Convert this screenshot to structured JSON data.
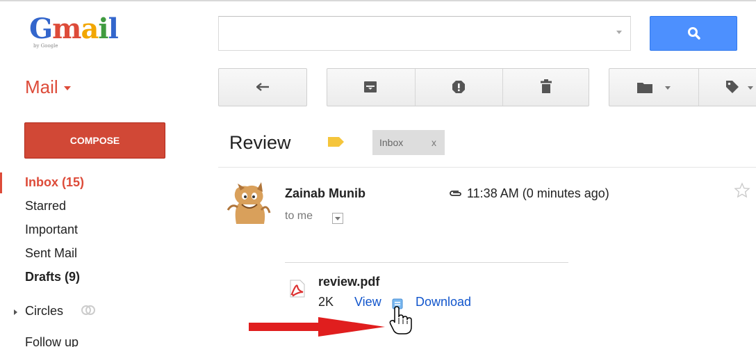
{
  "header": {
    "logo_text": "Gmail",
    "logo_subtext": "by Google",
    "search": {
      "value": "",
      "placeholder": ""
    }
  },
  "mail_menu": {
    "label": "Mail"
  },
  "toolbar": {
    "reply_icon": "reply-icon",
    "archive_icon": "archive-icon",
    "spam_icon": "report-spam-icon",
    "delete_icon": "trash-icon",
    "move_icon": "folder-icon",
    "labels_icon": "label-tag-icon"
  },
  "sidebar": {
    "compose_label": "COMPOSE",
    "items": [
      {
        "label": "Inbox (15)",
        "state": "active"
      },
      {
        "label": "Starred"
      },
      {
        "label": "Important"
      },
      {
        "label": "Sent Mail"
      },
      {
        "label": "Drafts (9)",
        "state": "bold"
      },
      {
        "label": "Circles"
      },
      {
        "label": "Follow up"
      }
    ]
  },
  "message": {
    "subject": "Review",
    "label_chip": {
      "text": "Inbox",
      "remove": "x"
    },
    "sender": "Zainab Munib",
    "recipient": "to me",
    "time": "11:38 AM (0 minutes ago)",
    "attachment": {
      "name": "review.pdf",
      "size": "2K",
      "view_label": "View",
      "download_label": "Download"
    }
  },
  "colors": {
    "brand_red": "#dd4b39",
    "compose_red": "#d14836",
    "search_blue": "#4d90fe",
    "link_blue": "#1155cc",
    "label_tag_yellow": "#f5c53b",
    "annotation_arrow": "#e01e1e"
  }
}
